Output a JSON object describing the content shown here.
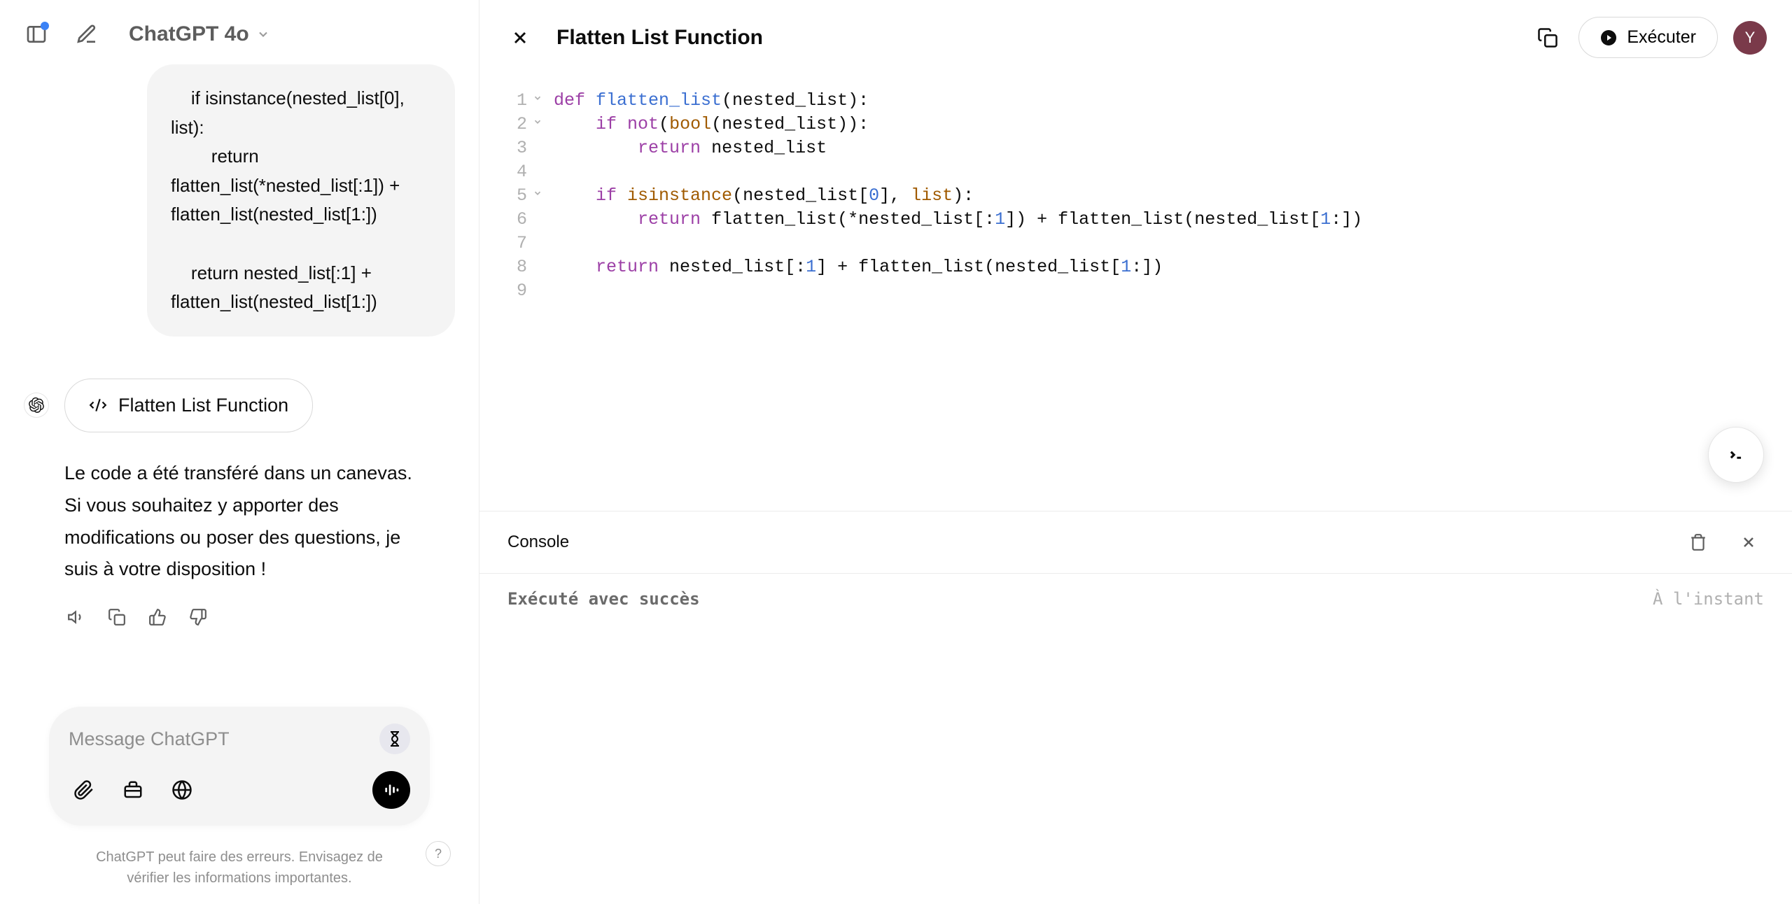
{
  "header": {
    "model_name": "ChatGPT 4o"
  },
  "chat": {
    "user_message": "    if isinstance(nested_list[0], list):\n        return flatten_list(*nested_list[:1]) + flatten_list(nested_list[1:])\n\n    return nested_list[:1] + flatten_list(nested_list[1:])",
    "canvas_chip_label": "Flatten List Function",
    "assistant_text": "Le code a été transféré dans un canevas. Si vous souhaitez y apporter des modifications ou poser des questions, je suis à votre disposition !"
  },
  "composer": {
    "placeholder": "Message ChatGPT"
  },
  "footer": {
    "note_line1": "ChatGPT peut faire des erreurs. Envisagez de",
    "note_line2": "vérifier les informations importantes.",
    "help": "?"
  },
  "canvas": {
    "title": "Flatten List Function",
    "run_label": "Exécuter",
    "avatar_initial": "Y",
    "code_lines": [
      {
        "n": 1,
        "fold": true,
        "tokens": [
          {
            "t": "def ",
            "c": "kw"
          },
          {
            "t": "flatten_list",
            "c": "fn"
          },
          {
            "t": "(nested_list):",
            "c": "pn"
          }
        ]
      },
      {
        "n": 2,
        "fold": true,
        "tokens": [
          {
            "t": "    ",
            "c": "pn"
          },
          {
            "t": "if ",
            "c": "kw"
          },
          {
            "t": "not",
            "c": "kw"
          },
          {
            "t": "(",
            "c": "pn"
          },
          {
            "t": "bool",
            "c": "bi"
          },
          {
            "t": "(nested_list)):",
            "c": "pn"
          }
        ]
      },
      {
        "n": 3,
        "fold": false,
        "tokens": [
          {
            "t": "        ",
            "c": "pn"
          },
          {
            "t": "return ",
            "c": "kw"
          },
          {
            "t": "nested_list",
            "c": "pn"
          }
        ]
      },
      {
        "n": 4,
        "fold": false,
        "tokens": [
          {
            "t": "",
            "c": "pn"
          }
        ]
      },
      {
        "n": 5,
        "fold": true,
        "tokens": [
          {
            "t": "    ",
            "c": "pn"
          },
          {
            "t": "if ",
            "c": "kw"
          },
          {
            "t": "isinstance",
            "c": "bi"
          },
          {
            "t": "(nested_list[",
            "c": "pn"
          },
          {
            "t": "0",
            "c": "num"
          },
          {
            "t": "], ",
            "c": "pn"
          },
          {
            "t": "list",
            "c": "bi"
          },
          {
            "t": "):",
            "c": "pn"
          }
        ]
      },
      {
        "n": 6,
        "fold": false,
        "tokens": [
          {
            "t": "        ",
            "c": "pn"
          },
          {
            "t": "return ",
            "c": "kw"
          },
          {
            "t": "flatten_list(*nested_list[:",
            "c": "pn"
          },
          {
            "t": "1",
            "c": "num"
          },
          {
            "t": "]) + flatten_list(nested_list[",
            "c": "pn"
          },
          {
            "t": "1",
            "c": "num"
          },
          {
            "t": ":])",
            "c": "pn"
          }
        ]
      },
      {
        "n": 7,
        "fold": false,
        "tokens": [
          {
            "t": "",
            "c": "pn"
          }
        ]
      },
      {
        "n": 8,
        "fold": false,
        "tokens": [
          {
            "t": "    ",
            "c": "pn"
          },
          {
            "t": "return ",
            "c": "kw"
          },
          {
            "t": "nested_list[:",
            "c": "pn"
          },
          {
            "t": "1",
            "c": "num"
          },
          {
            "t": "] + flatten_list(nested_list[",
            "c": "pn"
          },
          {
            "t": "1",
            "c": "num"
          },
          {
            "t": ":])",
            "c": "pn"
          }
        ]
      },
      {
        "n": 9,
        "fold": false,
        "tokens": [
          {
            "t": "",
            "c": "pn"
          }
        ]
      }
    ]
  },
  "console": {
    "label": "Console",
    "status": "Exécuté avec succès",
    "time": "À l'instant"
  }
}
